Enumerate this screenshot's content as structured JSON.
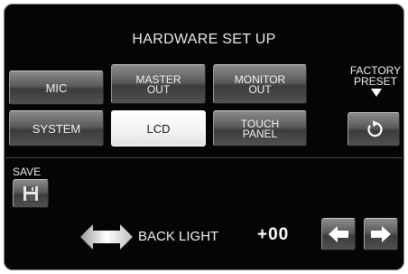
{
  "screen": {
    "title": "HARDWARE SET UP"
  },
  "tabs": [
    {
      "label": "MIC",
      "selected": false
    },
    {
      "label": "MASTER\nOUT",
      "selected": false
    },
    {
      "label": "MONITOR\nOUT",
      "selected": false
    },
    {
      "label": "SYSTEM",
      "selected": false
    },
    {
      "label": "LCD",
      "selected": true
    },
    {
      "label": "TOUCH\nPANEL",
      "selected": false
    }
  ],
  "factory_preset": {
    "label": "FACTORY\nPRESET",
    "icon": "reset-icon"
  },
  "save": {
    "label": "SAVE",
    "icon": "floppy-disk-icon"
  },
  "backlight": {
    "label": "BACK LIGHT",
    "value": "+00",
    "icon": "horizontal-double-arrow-icon",
    "decrease_icon": "left-arrow-icon",
    "increase_icon": "right-arrow-icon"
  }
}
